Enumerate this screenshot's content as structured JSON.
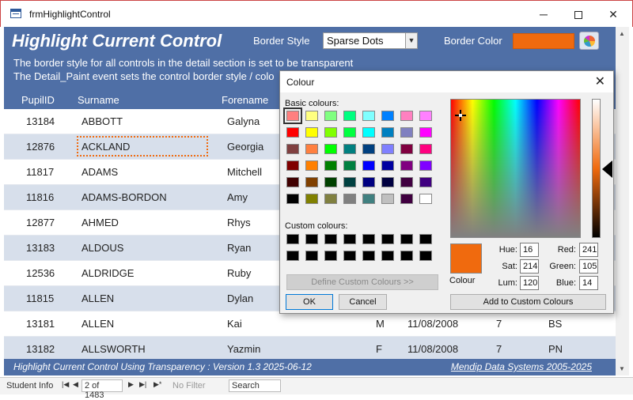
{
  "window": {
    "title": "frmHighlightControl",
    "minimize": "─",
    "close": "✕"
  },
  "header": {
    "title": "Highlight Current Control",
    "border_style_label": "Border Style",
    "border_style_value": "Sparse Dots",
    "border_color_label": "Border Color",
    "border_color": "#f06a0e",
    "desc_line1": "The border style for all controls in the detail section is set to be transparent",
    "desc_line2": "The Detail_Paint event sets the control border style / colo"
  },
  "columns": {
    "pupil_id": "PupilID",
    "surname": "Surname",
    "forename": "Forename"
  },
  "rows": [
    {
      "id": "13184",
      "surname": "ABBOTT",
      "forename": "Galyna",
      "gender": "",
      "dob": "",
      "year": "",
      "house": ""
    },
    {
      "id": "12876",
      "surname": "ACKLAND",
      "forename": "Georgia",
      "gender": "",
      "dob": "",
      "year": "",
      "house": ""
    },
    {
      "id": "11817",
      "surname": "ADAMS",
      "forename": "Mitchell",
      "gender": "",
      "dob": "",
      "year": "",
      "house": ""
    },
    {
      "id": "11816",
      "surname": "ADAMS-BORDON",
      "forename": "Amy",
      "gender": "",
      "dob": "",
      "year": "",
      "house": ""
    },
    {
      "id": "12877",
      "surname": "AHMED",
      "forename": "Rhys",
      "gender": "",
      "dob": "",
      "year": "",
      "house": ""
    },
    {
      "id": "13183",
      "surname": "ALDOUS",
      "forename": "Ryan",
      "gender": "",
      "dob": "",
      "year": "",
      "house": ""
    },
    {
      "id": "12536",
      "surname": "ALDRIDGE",
      "forename": "Ruby",
      "gender": "",
      "dob": "",
      "year": "",
      "house": ""
    },
    {
      "id": "11815",
      "surname": "ALLEN",
      "forename": "Dylan",
      "gender": "",
      "dob": "",
      "year": "",
      "house": ""
    },
    {
      "id": "13181",
      "surname": "ALLEN",
      "forename": "Kai",
      "gender": "M",
      "dob": "11/08/2008",
      "year": "7",
      "house": "BS"
    },
    {
      "id": "13182",
      "surname": "ALLSWORTH",
      "forename": "Yazmin",
      "gender": "F",
      "dob": "11/08/2008",
      "year": "7",
      "house": "PN"
    }
  ],
  "footer": {
    "left": "Highlight Current Control Using Transparency :  Version 1.3   2025-06-12",
    "right": "Mendip Data Systems 2005-2025"
  },
  "navbar": {
    "label": "Student Info",
    "position": "2 of 1483",
    "filter": "No Filter",
    "search": "Search"
  },
  "dialog": {
    "title": "Colour",
    "basic_label": "Basic colours:",
    "custom_label": "Custom colours:",
    "define_button": "Define Custom Colours >>",
    "ok_button": "OK",
    "cancel_button": "Cancel",
    "add_button": "Add to Custom Colours",
    "preview_label": "Colour",
    "hue_label": "Hue:",
    "hue": "16",
    "sat_label": "Sat:",
    "sat": "214",
    "lum_label": "Lum:",
    "lum": "120",
    "red_label": "Red:",
    "red": "241",
    "green_label": "Green:",
    "green": "105",
    "blue_label": "Blue:",
    "blue": "14",
    "basic_colours": [
      "#ff8080",
      "#ffff80",
      "#80ff80",
      "#00ff80",
      "#80ffff",
      "#0080ff",
      "#ff80c0",
      "#ff80ff",
      "#ff0000",
      "#ffff00",
      "#80ff00",
      "#00ff40",
      "#00ffff",
      "#0080c0",
      "#8080c0",
      "#ff00ff",
      "#804040",
      "#ff8040",
      "#00ff00",
      "#008080",
      "#004080",
      "#8080ff",
      "#800040",
      "#ff0080",
      "#800000",
      "#ff8000",
      "#008000",
      "#008040",
      "#0000ff",
      "#0000a0",
      "#800080",
      "#8000ff",
      "#400000",
      "#804000",
      "#004000",
      "#004040",
      "#000080",
      "#000040",
      "#400040",
      "#400080",
      "#000000",
      "#808000",
      "#808040",
      "#808080",
      "#408080",
      "#c0c0c0",
      "#400040",
      "#ffffff"
    ],
    "custom_colours": [
      "#000000",
      "#000000",
      "#000000",
      "#000000",
      "#000000",
      "#000000",
      "#000000",
      "#000000",
      "#000000",
      "#000000",
      "#000000",
      "#000000",
      "#000000",
      "#000000",
      "#000000",
      "#000000"
    ],
    "selected_basic_index": 0
  }
}
